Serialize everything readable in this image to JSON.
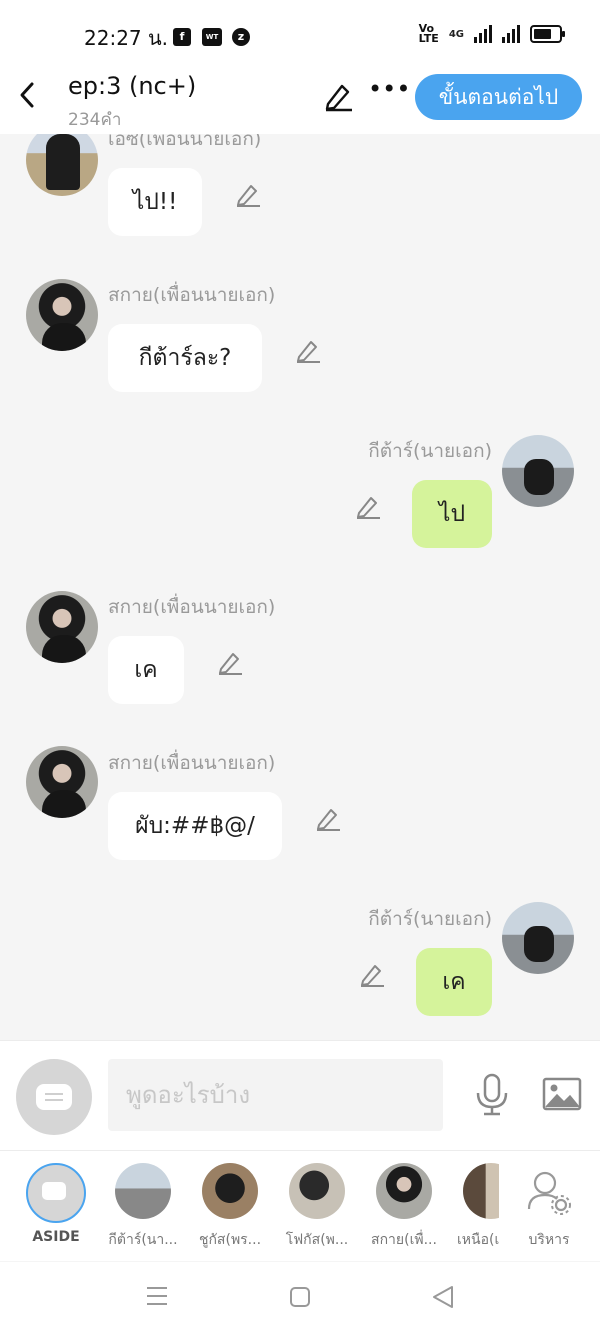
{
  "status_bar": {
    "time": "22:27 น.",
    "app_icons": [
      "facebook-icon",
      "webtoon-icon",
      "z-icon"
    ],
    "network": "4G"
  },
  "header": {
    "title": "ep:3 (nc+)",
    "word_count": "234คำ",
    "next_button": "ขั้นตอนต่อไป"
  },
  "messages": [
    {
      "side": "left",
      "name": "เอซ(เพื่อนนายเอก)",
      "text": "ไป!!",
      "avatar": "ace"
    },
    {
      "side": "left",
      "name": "สกาย(เพื่อนนายเอก)",
      "text": "กีต้าร์ละ?",
      "avatar": "skai"
    },
    {
      "side": "right",
      "name": "กีต้าร์(นายเอก)",
      "text": "ไป",
      "avatar": "guitar"
    },
    {
      "side": "left",
      "name": "สกาย(เพื่อนนายเอก)",
      "text": "เค",
      "avatar": "skai"
    },
    {
      "side": "left",
      "name": "สกาย(เพื่อนนายเอก)",
      "text": "ผับ:##฿@/",
      "avatar": "skai"
    },
    {
      "side": "right",
      "name": "กีต้าร์(นายเอก)",
      "text": "เค",
      "avatar": "guitar"
    }
  ],
  "input": {
    "placeholder": "พูดอะไรบ้าง"
  },
  "characters": [
    {
      "label": "ASIDE"
    },
    {
      "label": "กีต้าร์(นา..."
    },
    {
      "label": "ชูกัส(พร..."
    },
    {
      "label": "โฟกัส(พ..."
    },
    {
      "label": "สกาย(เพื่..."
    },
    {
      "label": "เหนือ(เ"
    },
    {
      "label": "บริหาร"
    }
  ],
  "colors": {
    "accent": "#4aa4ef",
    "own_bubble": "#d5f39b",
    "other_bubble": "#ffffff",
    "background": "#f5f5f5"
  }
}
